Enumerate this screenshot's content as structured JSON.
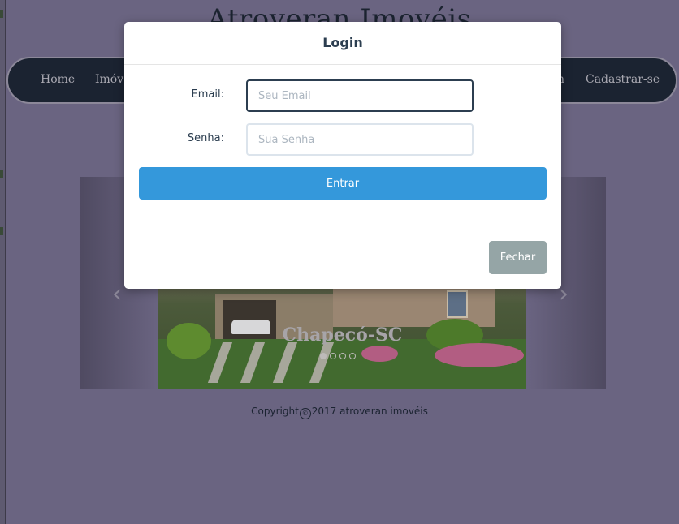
{
  "site": {
    "title": "Atroveran Imovéis"
  },
  "nav": {
    "items": [
      {
        "label": "Home"
      },
      {
        "label": "Imóv"
      },
      {
        "label": "n"
      },
      {
        "label": "Cadastrar-se"
      }
    ]
  },
  "carousel": {
    "caption": "Chapecó-SC",
    "slide_count": 4,
    "active_index": 0,
    "prev_icon": "chevron-left-icon",
    "next_icon": "chevron-right-icon"
  },
  "footer": {
    "prefix": "Copyright",
    "copyright_symbol": "©",
    "text": "2017 atroveran imovéis"
  },
  "modal": {
    "title": "Login",
    "email_label": "Email:",
    "email_placeholder": "Seu Email",
    "email_value": "",
    "password_label": "Senha:",
    "password_placeholder": "Sua Senha",
    "password_value": "",
    "submit_label": "Entrar",
    "close_label": "Fechar"
  },
  "colors": {
    "overlay_background": "#6a6481",
    "navbar": "#1b2331",
    "primary_button": "#3498db",
    "close_button": "#95a5a6"
  }
}
